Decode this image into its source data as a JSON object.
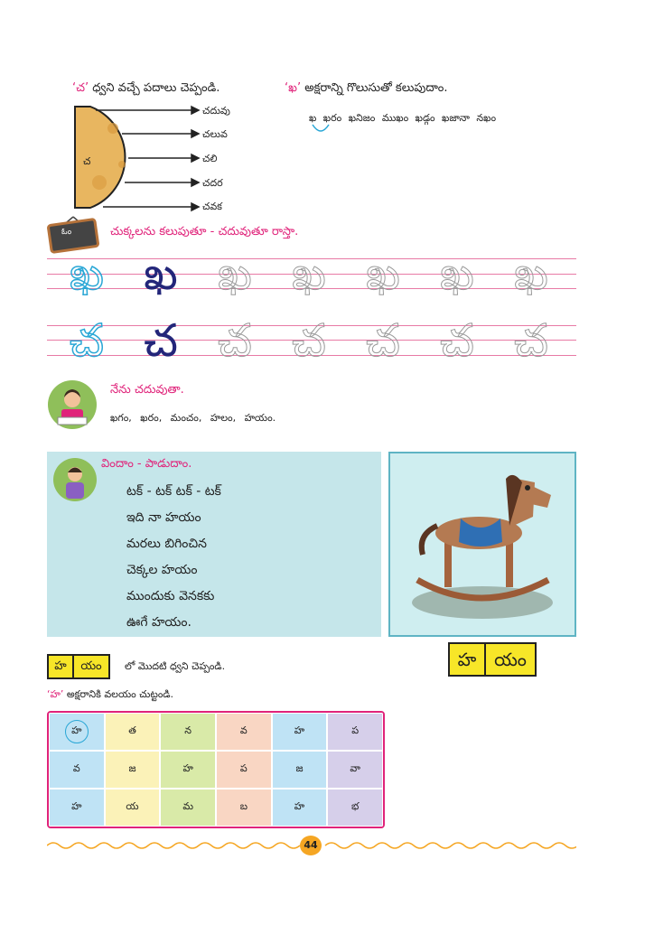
{
  "section1": {
    "title_quote": "‘చ’",
    "title_rest": " ధ్వని వచ్చే పదాలు చెప్పండి.",
    "center_letter": "చ",
    "words": [
      "చదువు",
      "చలువ",
      "చలి",
      "చదర",
      "చవక"
    ]
  },
  "section2": {
    "title_quote": "‘ఖ’",
    "title_rest": " అక్షరాన్ని గొలుసుతో కలుపుదాం.",
    "chain": "ఖ ఖరం ఖనిజం ముఖం ఖడ్గం ఖజానా నఖం"
  },
  "practice": {
    "slate_text": "ఓం",
    "title": "చుక్కలను కలుపుతూ - చదువుతూ రాస్తా.",
    "row1_letter": "ఖ",
    "row2_letter": "చ"
  },
  "reading": {
    "title": "నేను చదువుతా.",
    "words": "ఖగం, ఖరం, మంచం, హలం, హయం."
  },
  "song": {
    "title": "విందాం - పాడుదాం.",
    "lines": [
      "టక్ - టక్ టక్ - టక్",
      "ఇది నా హయం",
      "మరలు బిగించిన",
      "చెక్కల హయం",
      "ముందుకు వెనకకు",
      "ఊగే హయం."
    ]
  },
  "picture": {
    "word_parts": [
      "హ",
      "యం"
    ]
  },
  "sound": {
    "parts": [
      "హ",
      "యం"
    ],
    "text": "లో మొదటి ధ్వని చెప్పండి."
  },
  "circle_task": {
    "title_quote": "‘హ’",
    "title_rest": " అక్షరానికి వలయం చుట్టండి.",
    "rows": [
      [
        "హ",
        "త",
        "న",
        "వ",
        "హ",
        "ప"
      ],
      [
        "వ",
        "జ",
        "హ",
        "ప",
        "జ",
        "వా"
      ],
      [
        "హ",
        "య",
        "మ",
        "బ",
        "హ",
        "భ"
      ]
    ]
  },
  "page_number": "44",
  "colors": {
    "accent": "#e0237a",
    "highlight": "#f7e628",
    "song_bg": "#c5e6ea"
  }
}
